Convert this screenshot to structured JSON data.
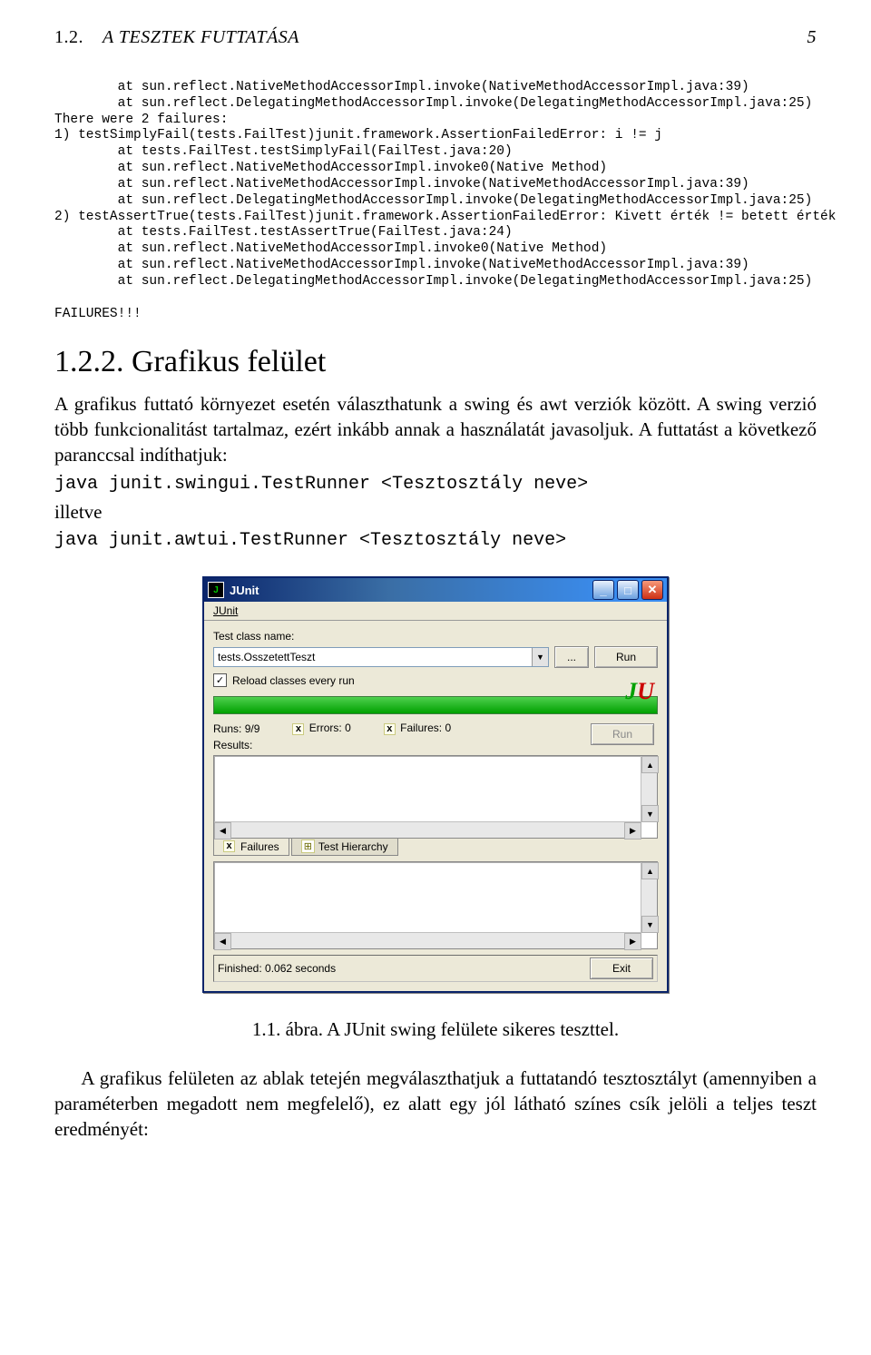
{
  "header": {
    "section": "1.2.",
    "title_it": "A TESZTEK FUTTATÁSA",
    "page_no": "5"
  },
  "code_block": "        at sun.reflect.NativeMethodAccessorImpl.invoke(NativeMethodAccessorImpl.java:39)\n        at sun.reflect.DelegatingMethodAccessorImpl.invoke(DelegatingMethodAccessorImpl.java:25)\nThere were 2 failures:\n1) testSimplyFail(tests.FailTest)junit.framework.AssertionFailedError: i != j\n        at tests.FailTest.testSimplyFail(FailTest.java:20)\n        at sun.reflect.NativeMethodAccessorImpl.invoke0(Native Method)\n        at sun.reflect.NativeMethodAccessorImpl.invoke(NativeMethodAccessorImpl.java:39)\n        at sun.reflect.DelegatingMethodAccessorImpl.invoke(DelegatingMethodAccessorImpl.java:25)\n2) testAssertTrue(tests.FailTest)junit.framework.AssertionFailedError: Kivett érték != betett érték\n        at tests.FailTest.testAssertTrue(FailTest.java:24)\n        at sun.reflect.NativeMethodAccessorImpl.invoke0(Native Method)\n        at sun.reflect.NativeMethodAccessorImpl.invoke(NativeMethodAccessorImpl.java:39)\n        at sun.reflect.DelegatingMethodAccessorImpl.invoke(DelegatingMethodAccessorImpl.java:25)\n\nFAILURES!!!",
  "heading": "1.2.2.   Grafikus felület",
  "para1": "A grafikus futtató környezet esetén választhatunk a swing és awt verziók között. A swing verzió több funkcionalitást tartalmaz, ezért inkább annak a használatát javasoljuk. A futtatást a következő paranccsal indíthatjuk:",
  "cmd1": "java junit.swingui.TestRunner <Tesztosztály neve>",
  "illetve": "illetve",
  "cmd2": "java junit.awtui.TestRunner <Tesztosztály neve>",
  "junit": {
    "window_title": "JUnit",
    "menu_junit": "JUnit",
    "test_class_label": "Test class name:",
    "combo_value": "tests.OsszetettTeszt",
    "browse_btn": "...",
    "run_btn": "Run",
    "reload": "Reload classes every run",
    "runs_label": "Runs:",
    "runs_val": "9/9",
    "errors_label": "Errors:",
    "errors_val": "0",
    "failures_label": "Failures:",
    "failures_val": "0",
    "results_label": "Results:",
    "side_run": "Run",
    "tab_failures": "Failures",
    "tab_hierarchy": "Test Hierarchy",
    "status_text": "Finished: 0.062 seconds",
    "exit_btn": "Exit"
  },
  "figure_caption": "1.1. ábra. A JUnit swing felülete sikeres teszttel.",
  "last_para": "A grafikus felületen az ablak tetején megválaszthatjuk a futtatandó tesztosztályt (amennyiben a paraméterben megadott nem megfelelő), ez alatt egy jól látható színes csík jelöli a teljes teszt eredményét:"
}
